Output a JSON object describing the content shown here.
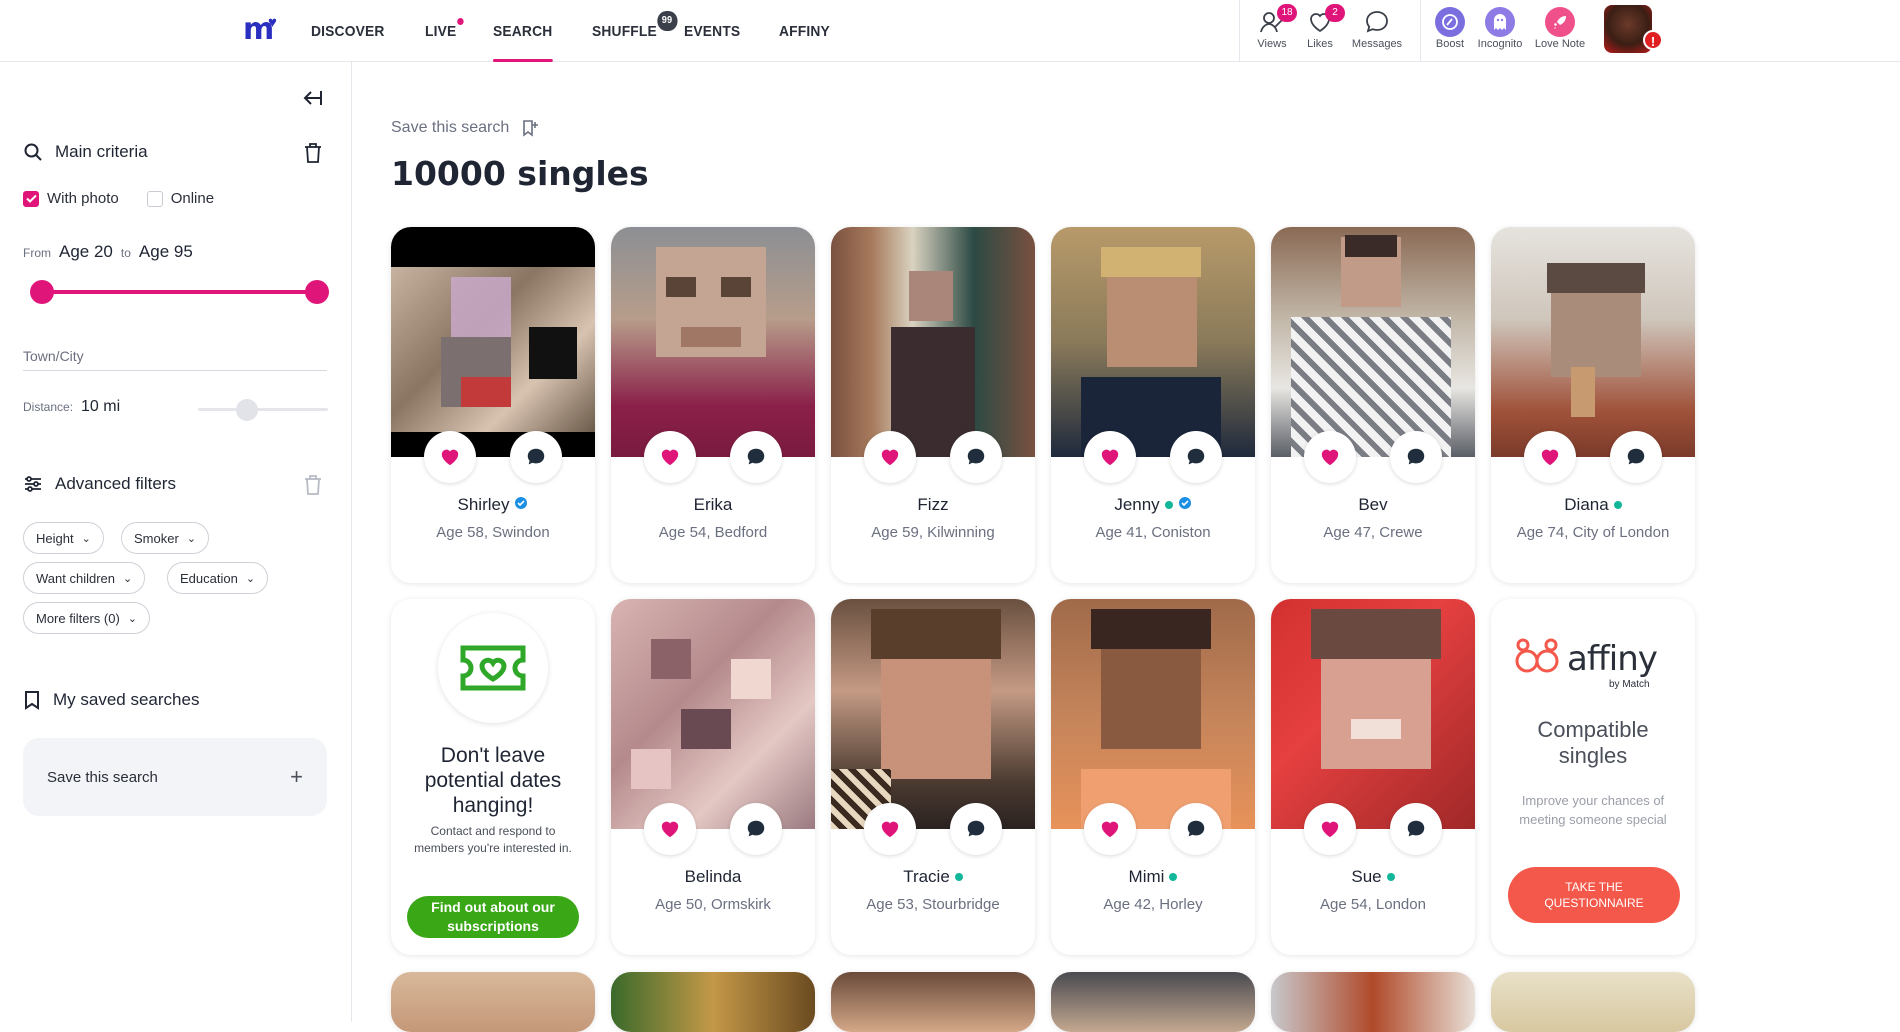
{
  "nav": {
    "items": [
      "DISCOVER",
      "LIVE",
      "SEARCH",
      "SHUFFLE",
      "EVENTS",
      "AFFINY"
    ],
    "active": "SEARCH",
    "shuffle_badge": "99"
  },
  "actions": {
    "views": {
      "label": "Views",
      "badge": "18"
    },
    "likes": {
      "label": "Likes",
      "badge": "2"
    },
    "messages": {
      "label": "Messages"
    },
    "boost": {
      "label": "Boost"
    },
    "incognito": {
      "label": "Incognito"
    },
    "love_note": {
      "label": "Love Note"
    },
    "avatar_alert": "!"
  },
  "sidebar": {
    "main_criteria": "Main criteria",
    "with_photo": "With photo",
    "online": "Online",
    "age_from_label": "From",
    "age_from": "Age 20",
    "age_to_label": "to",
    "age_to": "Age 95",
    "town_placeholder": "Town/City",
    "distance_label": "Distance:",
    "distance_value": "10 mi",
    "advanced_filters": "Advanced filters",
    "filters": [
      "Height",
      "Smoker",
      "Want children",
      "Education",
      "More filters (0)"
    ],
    "saved_searches": "My saved searches",
    "save_this_search": "Save this search"
  },
  "main": {
    "save_search": "Save this search",
    "results_title": "10000 singles"
  },
  "profiles": [
    {
      "name": "Shirley",
      "meta": "Age 58, Swindon",
      "online": false,
      "verified": true
    },
    {
      "name": "Erika",
      "meta": "Age 54, Bedford",
      "online": false,
      "verified": false
    },
    {
      "name": "Fizz",
      "meta": "Age 59, Kilwinning",
      "online": false,
      "verified": false
    },
    {
      "name": "Jenny",
      "meta": "Age 41, Coniston",
      "online": true,
      "verified": true
    },
    {
      "name": "Bev",
      "meta": "Age 47, Crewe",
      "online": false,
      "verified": false
    },
    {
      "name": "Diana",
      "meta": "Age 74, City of London",
      "online": true,
      "verified": false
    },
    {
      "name": "Belinda",
      "meta": "Age 50, Ormskirk",
      "online": false,
      "verified": false
    },
    {
      "name": "Tracie",
      "meta": "Age 53, Stourbridge",
      "online": true,
      "verified": false
    },
    {
      "name": "Mimi",
      "meta": "Age 42, Horley",
      "online": true,
      "verified": false
    },
    {
      "name": "Sue",
      "meta": "Age 54, London",
      "online": true,
      "verified": false
    }
  ],
  "promo": {
    "title": "Don't leave potential dates hanging!",
    "text": "Contact and respond to members you're interested in.",
    "button": "Find out about our subscriptions"
  },
  "affiny": {
    "brand": "affiny",
    "by": "by Match",
    "title": "Compatible singles",
    "text": "Improve your chances of meeting someone special",
    "button": "TAKE THE QUESTIONNAIRE"
  },
  "colors": {
    "accent": "#e0157a",
    "brand_blue": "#2b2fbf",
    "online": "#12b79a",
    "verified": "#1a8fe3",
    "promo_green": "#3aa716",
    "affiny_coral": "#f3584a"
  }
}
